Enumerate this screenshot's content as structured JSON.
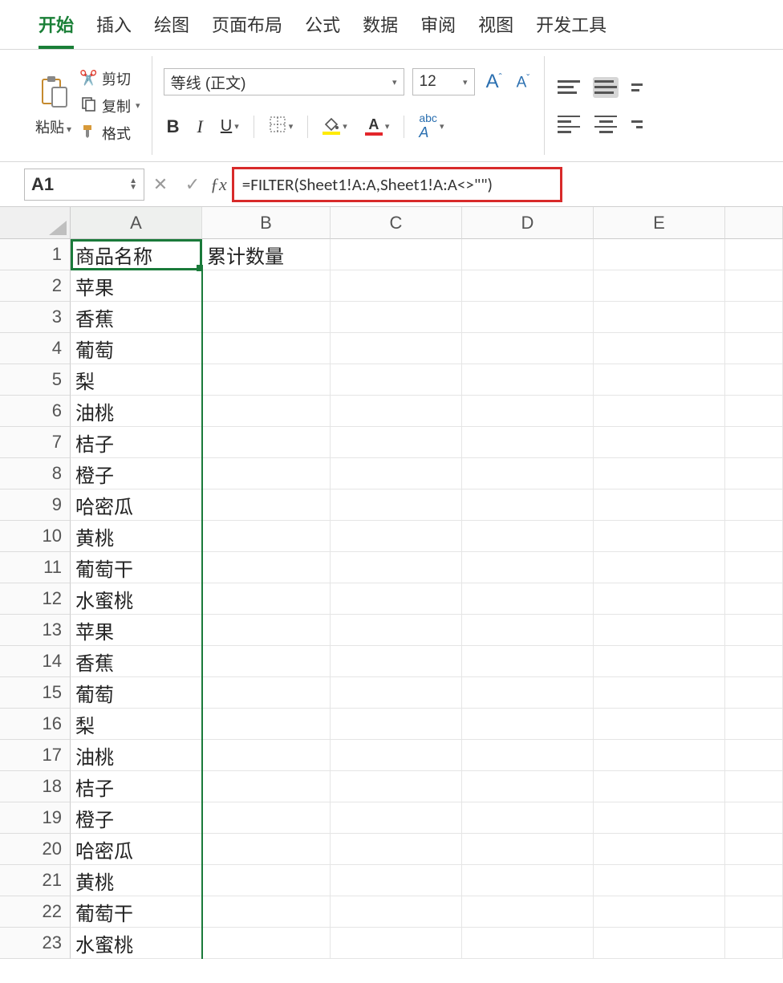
{
  "tabs": [
    "开始",
    "插入",
    "绘图",
    "页面布局",
    "公式",
    "数据",
    "审阅",
    "视图",
    "开发工具"
  ],
  "active_tab_index": 0,
  "clipboard": {
    "paste_label": "粘贴",
    "cut_label": "剪切",
    "copy_label": "复制",
    "format_label": "格式"
  },
  "font": {
    "name": "等线 (正文)",
    "size": "12"
  },
  "name_box": "A1",
  "formula": "=FILTER(Sheet1!A:A,Sheet1!A:A<>\"\")",
  "columns": [
    "A",
    "B",
    "C",
    "D",
    "E",
    ""
  ],
  "row_count": 23,
  "colB_header": "累计数量",
  "colA_values": [
    "商品名称",
    "苹果",
    "香蕉",
    "葡萄",
    "梨",
    "油桃",
    "桔子",
    "橙子",
    "哈密瓜",
    "黄桃",
    "葡萄干",
    "水蜜桃",
    "苹果",
    "香蕉",
    "葡萄",
    "梨",
    "油桃",
    "桔子",
    "橙子",
    "哈密瓜",
    "黄桃",
    "葡萄干",
    "水蜜桃"
  ]
}
